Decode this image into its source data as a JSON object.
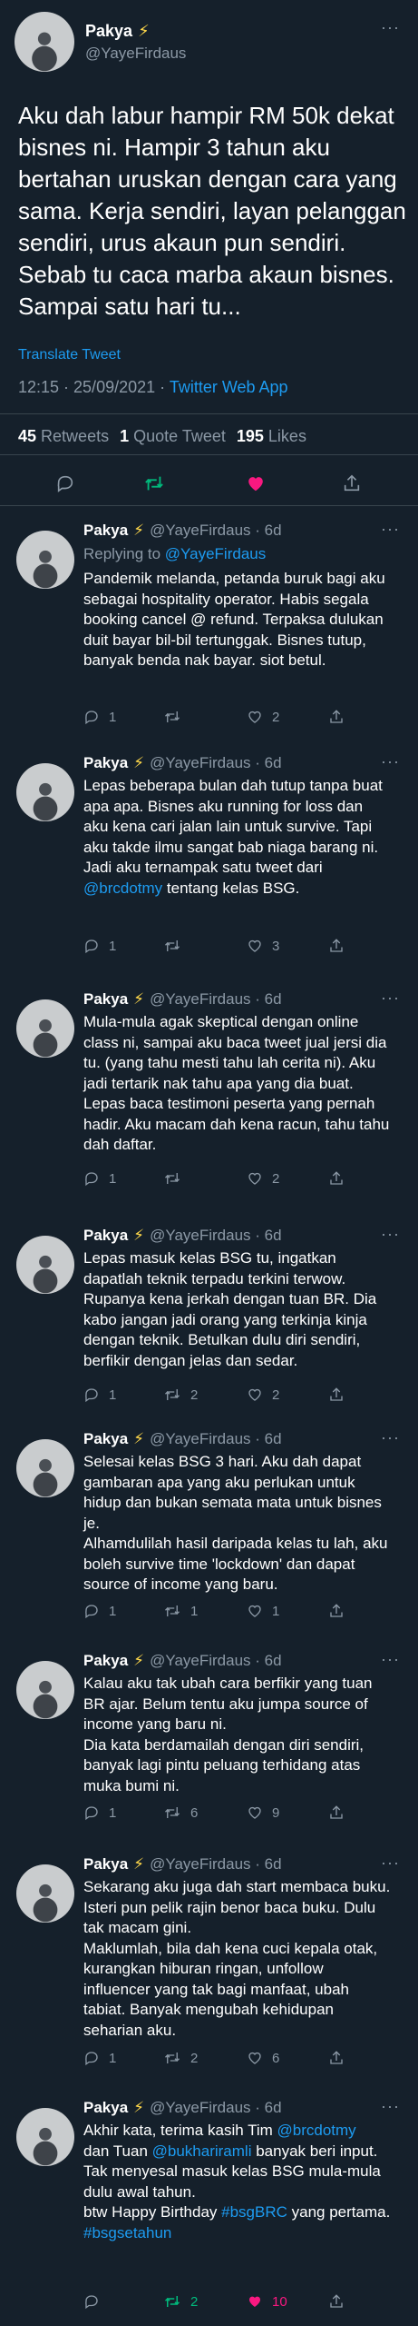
{
  "main": {
    "name": "Pakya",
    "badge": "⚡",
    "handle": "@YayeFirdaus",
    "text": "Aku dah labur hampir RM 50k dekat bisnes ni. Hampir 3 tahun aku bertahan uruskan dengan cara yang sama. Kerja sendiri, layan pelanggan sendiri, urus akaun pun sendiri. Sebab tu caca marba akaun bisnes. Sampai satu hari tu...",
    "translate": "Translate Tweet",
    "time": "12:15 · 25/09/2021 ·",
    "source": "Twitter Web App",
    "retweets_count": "45",
    "retweets_label": "Retweets",
    "quotes_count": "1",
    "quotes_label": "Quote Tweet",
    "likes_count": "195",
    "likes_label": "Likes"
  },
  "replies": [
    {
      "name": "Pakya",
      "badge": "⚡",
      "handle": "@YayeFirdaus · 6d",
      "replying_prefix": "Replying to",
      "replying_to": "@YayeFirdaus",
      "text": "Pandemik melanda, petanda buruk bagi aku sebagai hospitality operator. Habis segala booking cancel @ refund. Terpaksa dulukan duit bayar bil-bil tertunggak. Bisnes tutup, banyak benda nak bayar. siot betul.",
      "reply_count": "1",
      "retweet_count": "",
      "like_count": "2"
    },
    {
      "name": "Pakya",
      "badge": "⚡",
      "handle": "@YayeFirdaus · 6d",
      "text_before": "Lepas beberapa bulan dah tutup tanpa buat apa apa. Bisnes aku running for loss dan aku kena cari jalan lain untuk survive. Tapi aku takde ilmu sangat bab niaga barang ni. Jadi aku ternampak satu tweet dari ",
      "text_link": "@brcdotmy",
      "text_after": "  tentang kelas BSG.",
      "reply_count": "1",
      "retweet_count": "",
      "like_count": "3"
    },
    {
      "name": "Pakya",
      "badge": "⚡",
      "handle": "@YayeFirdaus · 6d",
      "text": "Mula-mula agak skeptical dengan online class ni, sampai aku baca tweet jual jersi dia tu. (yang tahu mesti tahu lah cerita ni). Aku jadi tertarik nak tahu apa yang dia buat. Lepas baca testimoni peserta yang pernah hadir. Aku macam dah kena racun, tahu tahu dah daftar.",
      "reply_count": "1",
      "retweet_count": "",
      "like_count": "2"
    },
    {
      "name": "Pakya",
      "badge": "⚡",
      "handle": "@YayeFirdaus · 6d",
      "text": "Lepas masuk kelas BSG tu, ingatkan dapatlah teknik terpadu terkini terwow. Rupanya kena jerkah dengan tuan BR. Dia kabo jangan jadi orang yang terkinja kinja dengan teknik. Betulkan dulu diri sendiri, berfikir dengan jelas dan sedar.",
      "reply_count": "1",
      "retweet_count": "2",
      "like_count": "2"
    },
    {
      "name": "Pakya",
      "badge": "⚡",
      "handle": "@YayeFirdaus · 6d",
      "text": "Selesai kelas BSG 3 hari. Aku dah dapat gambaran apa yang aku perlukan untuk hidup dan bukan semata mata untuk bisnes je.\nAlhamdulilah hasil daripada kelas tu lah, aku boleh survive time 'lockdown' dan dapat source of income yang baru.",
      "reply_count": "1",
      "retweet_count": "1",
      "like_count": "1"
    },
    {
      "name": "Pakya",
      "badge": "⚡",
      "handle": "@YayeFirdaus · 6d",
      "text": "Kalau aku tak ubah cara berfikir yang tuan BR ajar. Belum tentu aku jumpa source of income yang baru ni.\nDia kata berdamailah dengan diri sendiri, banyak lagi pintu peluang terhidang atas muka bumi ni.",
      "reply_count": "1",
      "retweet_count": "6",
      "like_count": "9"
    },
    {
      "name": "Pakya",
      "badge": "⚡",
      "handle": "@YayeFirdaus · 6d",
      "text": "Sekarang aku juga dah start membaca buku. Isteri pun pelik rajin benor baca buku. Dulu tak macam gini.\nMaklumlah, bila dah kena cuci kepala otak, kurangkan hiburan ringan, unfollow influencer yang tak bagi manfaat, ubah tabiat. Banyak mengubah kehidupan seharian aku.",
      "reply_count": "1",
      "retweet_count": "2",
      "like_count": "6"
    },
    {
      "name": "Pakya",
      "badge": "⚡",
      "handle": "@YayeFirdaus · 6d",
      "t1": "Akhir kata, terima kasih Tim ",
      "l1": "@brcdotmy",
      "t2": "dan Tuan ",
      "l2": "@bukhariramli",
      "t3": " banyak beri input. Tak menyesal masuk kelas BSG mula-mula dulu awal tahun.\nbtw Happy Birthday ",
      "l3": "#bsgBRC",
      "t4": " yang pertama.",
      "l4": "#bsgsetahun",
      "reply_count": "",
      "retweet_count": "2",
      "like_count": "10"
    }
  ],
  "icons": {
    "reply": "reply-icon",
    "retweet": "retweet-icon",
    "like": "heart-icon",
    "share": "share-icon",
    "more": "more-icon"
  },
  "colors": {
    "background": "#15202b",
    "accent": "#1d9bf0",
    "retweet": "#00ba7c",
    "like": "#f91880",
    "muted": "#8b98a5"
  },
  "more_glyph": "···"
}
